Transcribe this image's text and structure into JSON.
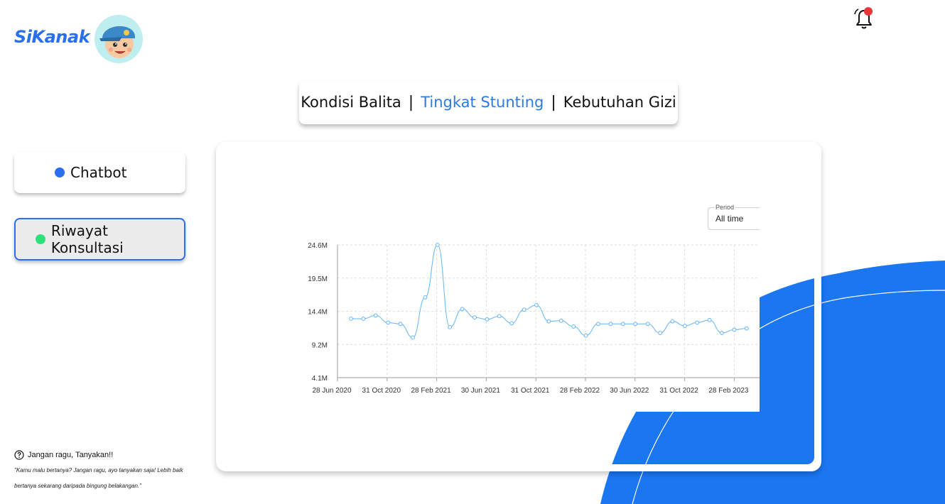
{
  "brand": {
    "name": "SiKanak"
  },
  "header": {
    "notification_icon": "bell-icon"
  },
  "tabs": [
    {
      "label": "Kondisi Balita",
      "active": false
    },
    {
      "label": "Tingkat Stunting",
      "active": true
    },
    {
      "label": "Kebutuhan Gizi",
      "active": false
    }
  ],
  "tab_separator": "|",
  "sidebar": {
    "items": [
      {
        "label": "Chatbot",
        "dot_color": "#2a6ff0"
      },
      {
        "label": "Riwayat Konsultasi",
        "dot_color": "#2ee07a",
        "selected": true
      }
    ]
  },
  "help": {
    "icon": "question-circle-icon",
    "title": "Jangan ragu, Tanyakan!!",
    "body": "\"Kamu malu bertanya? Jangan ragu, ayo tanyakan saja! Lebih baik bertanya sekarang daripada bingung belakangan.\""
  },
  "period": {
    "label": "Period",
    "value": "All time"
  },
  "colors": {
    "accent": "#2a6ff0",
    "blob": "#1b76f2",
    "line": "#64b5f6"
  },
  "chart_data": {
    "type": "line",
    "ylim": [
      4.1,
      24.6
    ],
    "y_ticks": [
      "4.1M",
      "9.2M",
      "14.4M",
      "19.5M",
      "24.6M"
    ],
    "x_ticks": [
      "28 Jun 2020",
      "31 Oct 2020",
      "28 Feb 2021",
      "30 Jun 2021",
      "31 Oct 2021",
      "28 Feb 2022",
      "30 Jun 2022",
      "31 Oct 2022",
      "28 Feb 2023"
    ],
    "grid": true,
    "series": [
      {
        "values": [
          13.2,
          13.2,
          13.7,
          12.6,
          12.4,
          10.3,
          16.5,
          24.6,
          11.9,
          14.7,
          13.4,
          13.1,
          13.6,
          12.5,
          14.6,
          15.3,
          12.8,
          12.9,
          12.0,
          10.6,
          12.4,
          12.4,
          12.4,
          12.4,
          12.4,
          11.0,
          12.8,
          12.1,
          12.6,
          13.0,
          11.0,
          11.5,
          11.7
        ]
      }
    ]
  }
}
